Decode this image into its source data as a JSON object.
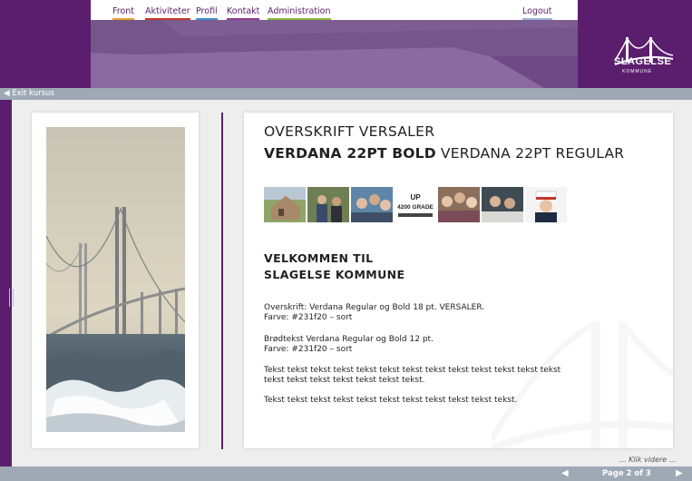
{
  "nav": {
    "items": [
      "Front",
      "Aktiviteter",
      "Profil",
      "Kontakt",
      "Administration"
    ],
    "logout": "Logout"
  },
  "logo": {
    "name": "SLAGELSE",
    "sub": "KOMMUNE"
  },
  "exit": {
    "label": "Exit kursus",
    "icon": "arrow-left-icon"
  },
  "content": {
    "heading1": "OVERSKRIFT VERSALER",
    "heading2_bold": "VERDANA 22PT BOLD",
    "heading2_regular": " VERDANA 22PT REGULAR",
    "thumbnail_text": "UP 4200 GRADE",
    "welcome_line1": "VELKOMMEN TIL",
    "welcome_line2": "SLAGELSE KOMMUNE",
    "para1_line1": "Overskrift: Verdana Regular og Bold 18 pt. VERSALER.",
    "para1_line2": "Farve: #231f20 – sort",
    "para2_line1": "Brødtekst Verdana Regular og Bold 12 pt.",
    "para2_line2": "Farve: #231f20 – sort",
    "para3_line1": "Tekst tekst tekst tekst tekst tekst tekst tekst tekst tekst tekst tekst tekst",
    "para3_line2": "tekst tekst tekst tekst tekst tekst tekst.",
    "para4_line1": "Tekst tekst tekst tekst tekst tekst tekst tekst tekst tekst tekst."
  },
  "pagination": {
    "klik_videre": "... Klik videre ...",
    "page_text": "Page 2 of 3",
    "prev_icon": "triangle-left-icon",
    "next_icon": "triangle-right-icon"
  },
  "colors": {
    "brand_purple": "#5b1e6e",
    "text": "#231f20",
    "bar_gray": "#9ea9b5"
  }
}
